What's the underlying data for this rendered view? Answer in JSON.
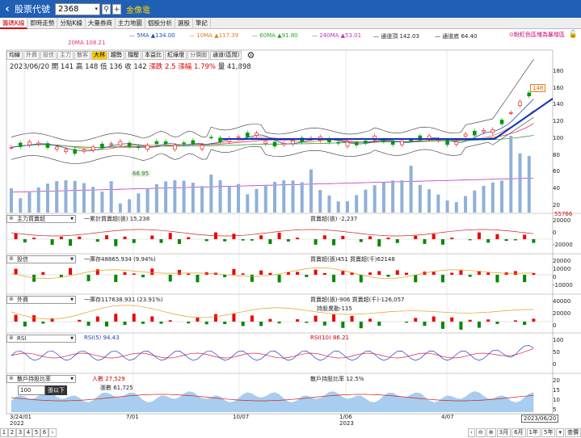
{
  "header": {
    "back_icon": "chevron-left-icon",
    "title": "股票代號",
    "code": "2368",
    "stock_name": "金像電"
  },
  "tabs": [
    "籌碼K線",
    "即時走勢",
    "分點K線",
    "大量券商",
    "主力地圖",
    "個股分析",
    "選股",
    "筆記"
  ],
  "ma_legend": [
    {
      "label": "20MA 108.21",
      "color": "#e03070"
    },
    {
      "label": "5MA ▲134.00",
      "color": "#2050c0"
    },
    {
      "label": "10MA ▲117.39",
      "color": "#e08020"
    },
    {
      "label": "60MA ▲91.80",
      "color": "#30a030"
    },
    {
      "label": "240MA ▲53.01",
      "color": "#c030c0"
    },
    {
      "label": "通道頂 142.03",
      "color": "#333333"
    },
    {
      "label": "通道底 64.40",
      "color": "#333333"
    }
  ],
  "pill_button": "⊙粉紅色區塊為暴增區",
  "toolbar": [
    "均線",
    "外資",
    "投信",
    "主力",
    "散客",
    "大林",
    "趨勢",
    "撐壓",
    "本益比",
    "紅綠燈",
    "分價圖",
    "通道(區間)"
  ],
  "ohlc": {
    "date": "2023/06/20",
    "open_label": "開",
    "open": "141",
    "high_label": "高",
    "high": "148",
    "low_label": "低",
    "low": "136",
    "close_label": "收",
    "close": "142",
    "change": "漲跌 2.5",
    "pct": "漲幅 1.79%",
    "vol": "量 41,898"
  },
  "price_badge_high": "148",
  "price_badge_low": "66.95",
  "price_axis": [
    "180",
    "160",
    "140",
    "120",
    "100",
    "80",
    "60",
    "40",
    "20"
  ],
  "panels": [
    {
      "select": "主力買賣超",
      "left": "一累計買賣超(張) 15,238",
      "right": "買賣超(張) -2,237",
      "axis": [
        "55766",
        "20000",
        "0",
        "-20000"
      ]
    },
    {
      "select": "投信",
      "left": "一庫存48865.934 (9.94%)",
      "right": "買賣超(張)451 買賣超(千)62148",
      "axis": [
        "20000",
        "10000",
        "0",
        "-10000"
      ]
    },
    {
      "select": "外資",
      "left": "一庫存117638.931 (23.91%)",
      "right": "買賣超(張)-906 買賣超(千)-126,057",
      "right2": "持股異動-115",
      "axis": [
        "40000",
        "20000",
        "0"
      ]
    },
    {
      "select": "RSI",
      "left": "RSI(5) 94.43",
      "right": "RSI(10) 86.21",
      "axis": [
        "100",
        "50",
        "0"
      ]
    },
    {
      "select": "散戶持股比率",
      "left": "人數 27,529",
      "left2": "張數 61,725",
      "right": "散戶持股比率 12.5%",
      "axis": [
        "20",
        "15",
        "10",
        "5"
      ]
    }
  ],
  "hold_select": {
    "value": "100",
    "unit": "張以下"
  },
  "dates": [
    {
      "d": "3/24/01",
      "y": "2022"
    },
    {
      "d": "7/01",
      "y": ""
    },
    {
      "d": "10/07",
      "y": ""
    },
    {
      "d": "1/06",
      "y": "2023"
    },
    {
      "d": "4/07",
      "y": ""
    }
  ],
  "current_date": "2023/06/20",
  "pager": [
    "1",
    "2",
    "3",
    "4",
    "5",
    "6"
  ],
  "ranges": [
    "3月",
    "6月",
    "1年",
    "5年",
    "查價"
  ],
  "chart_data": {
    "type": "line",
    "title": "",
    "series": [
      {
        "name": "5MA",
        "values": [
          82,
          84,
          86,
          85,
          87,
          88,
          86,
          84,
          85,
          87,
          88,
          86,
          85,
          87,
          96,
          94,
          93,
          95,
          97,
          96,
          95,
          92,
          90,
          91,
          93,
          92,
          92,
          93,
          91,
          90,
          92,
          95,
          98,
          100,
          105,
          125,
          138,
          142
        ]
      },
      {
        "name": "收",
        "values": [
          82,
          85,
          86,
          84,
          88,
          87,
          86,
          83,
          86,
          88,
          87,
          86,
          85,
          88,
          97,
          93,
          92,
          95,
          96,
          96,
          94,
          91,
          90,
          91,
          93,
          92,
          92,
          93,
          91,
          90,
          92,
          96,
          98,
          101,
          110,
          128,
          140,
          142
        ]
      }
    ],
    "ylim": [
      20,
      180
    ]
  }
}
